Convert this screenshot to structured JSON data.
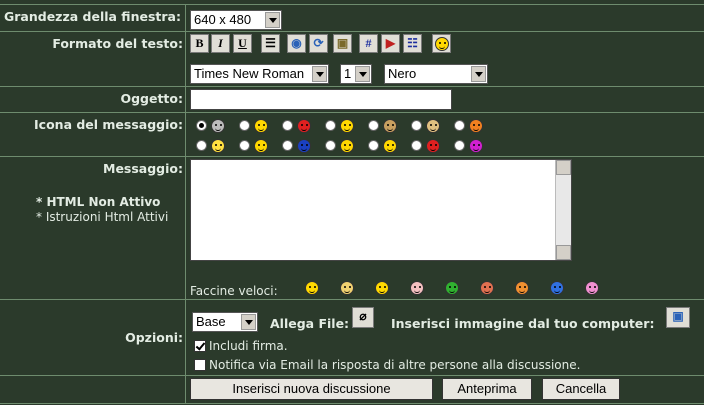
{
  "window_size": {
    "label": "Grandezza della finestra:",
    "value": "640 x 480"
  },
  "format": {
    "label": "Formato del testo:",
    "bold": "B",
    "italic": "I",
    "underline": "U",
    "sep": "#",
    "font": "Times New Roman",
    "size": "1",
    "color": "Nero",
    "icons": [
      "bold-icon",
      "italic-icon",
      "underline-icon",
      "center-align-icon",
      "link-icon",
      "refresh-icon",
      "image-icon",
      "hash-icon",
      "quote-icon",
      "list-icon",
      "smiley-icon"
    ]
  },
  "subject": {
    "label": "Oggetto:",
    "value": ""
  },
  "message_icon": {
    "label": "Icona del messaggio:"
  },
  "message": {
    "label": "Messaggio:",
    "html_off": "* HTML Non Attivo",
    "html_help": "* Istruzioni Html Attivi",
    "value": "",
    "quick_smileys": "Faccine veloci:"
  },
  "options": {
    "label": "Opzioni:",
    "mode": "Base",
    "attach_label": "Allega File:",
    "insert_image_label": "Inserisci immagine dal tuo computer:",
    "include_signature": "Includi firma.",
    "notify": "Notifica via Email la risposta di altre persone alla discussione."
  },
  "buttons": {
    "submit": "Inserisci nuova discussione",
    "preview": "Anteprima",
    "cancel": "Cancella"
  },
  "colors": {
    "bg": "#2b3a2b",
    "border": "#6e8c6e",
    "label": "#e3ece3"
  }
}
